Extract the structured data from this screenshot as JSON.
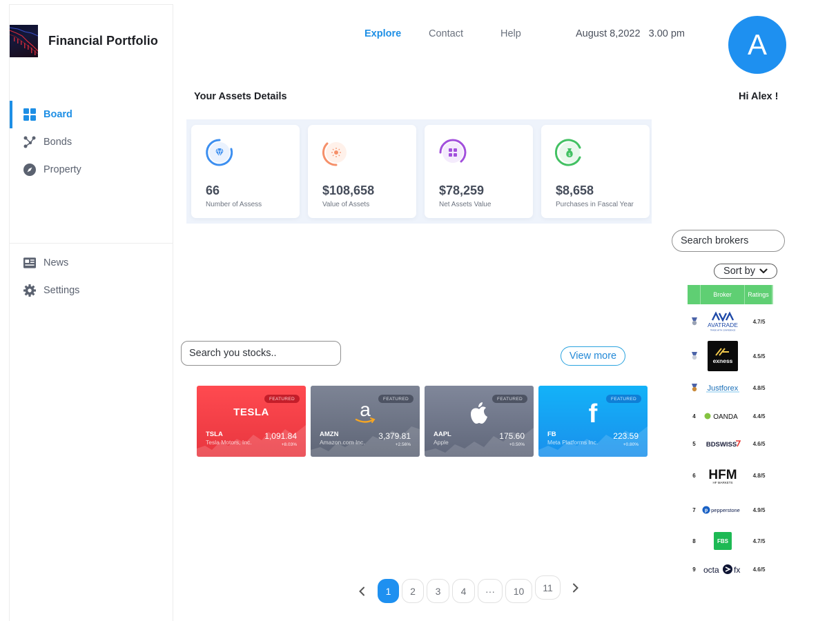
{
  "app": {
    "title": "Financial Portfolio"
  },
  "sidebar": {
    "items": [
      {
        "label": "Board",
        "icon": "grid-icon",
        "active": true
      },
      {
        "label": "Bonds",
        "icon": "nodes-icon"
      },
      {
        "label": "Property",
        "icon": "compass-icon"
      }
    ],
    "bottom_items": [
      {
        "label": "News",
        "icon": "newspaper-icon"
      },
      {
        "label": "Settings",
        "icon": "gear-icon"
      }
    ]
  },
  "topnav": {
    "explore": "Explore",
    "contact": "Contact",
    "help": "Help",
    "datetime": "August 8,2022   3.00 pm"
  },
  "user": {
    "initial": "A",
    "greeting": "Hi Alex !"
  },
  "assets": {
    "title": "Your Assets Details",
    "cards": [
      {
        "value": "66",
        "label": "Number of Assess",
        "color": "#3d8ff0"
      },
      {
        "value": "$108,658",
        "label": "Value of Assets",
        "color": "#f5906a"
      },
      {
        "value": "$78,259",
        "label": "Net Assets Value",
        "color": "#a24fdc"
      },
      {
        "value": "$8,658",
        "label": "Purchases in Fascal Year",
        "color": "#43c163"
      }
    ]
  },
  "brokers": {
    "search_placeholder": "Search brokers",
    "sort_label": "Sort by",
    "header": {
      "broker": "Broker",
      "ratings": "Ratings"
    },
    "rows": [
      {
        "rank": "1",
        "name": "AVATRADE",
        "tagline": "TRADE WITH CONFIDENCE",
        "rating": "4.7/5"
      },
      {
        "rank": "2",
        "name": "exness",
        "rating": "4.5/5"
      },
      {
        "rank": "3",
        "name": "Justforex",
        "rating": "4.8/5"
      },
      {
        "rank": "4",
        "name": "OANDA",
        "rating": "4.4/5"
      },
      {
        "rank": "5",
        "name": "BDSWISS",
        "rating": "4.6/5"
      },
      {
        "rank": "6",
        "name": "HFM",
        "tagline": "HF MARKETS",
        "rating": "4.8/5"
      },
      {
        "rank": "7",
        "name": "pepperstone",
        "rating": "4.9/5"
      },
      {
        "rank": "8",
        "name": "FBS",
        "rating": "4.7/5"
      },
      {
        "rank": "9",
        "name": "octa",
        "suffix": "fx",
        "rating": "4.6/5"
      }
    ]
  },
  "stocks": {
    "search_placeholder": "Search you stocks..",
    "view_more": "View more",
    "featured_label": "FEATURED",
    "cards": [
      {
        "ticker": "TSLA",
        "company": "Tesla Motors, Inc.",
        "price": "1,091.84",
        "change": "+8.03%",
        "logo_text": "TESLA",
        "color": "#f0444c"
      },
      {
        "ticker": "AMZN",
        "company": "Amazon.com Inc.",
        "price": "3,379.81",
        "change": "+2.56%",
        "logo_text": "a",
        "color": "#6c7384"
      },
      {
        "ticker": "AAPL",
        "company": "Apple",
        "price": "175.60",
        "change": "+0.50%",
        "logo_text": "",
        "color": "#737a8a"
      },
      {
        "ticker": "FB",
        "company": "Meta Platforms Inc.",
        "price": "223.59",
        "change": "+0.80%",
        "logo_text": "f",
        "color": "#1aa6f2"
      }
    ]
  },
  "pagination": {
    "pages": [
      "1",
      "2",
      "3",
      "4",
      "···",
      "10",
      "11"
    ],
    "current": "1"
  }
}
